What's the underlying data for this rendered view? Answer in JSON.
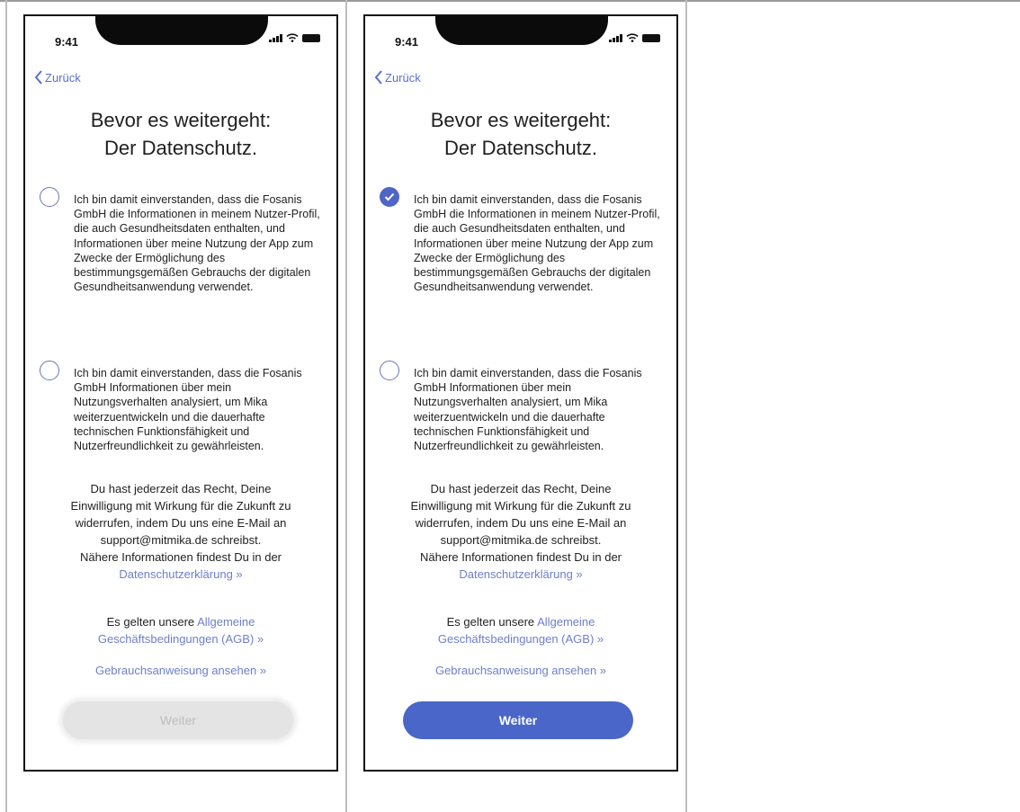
{
  "status": {
    "time": "9:41"
  },
  "nav": {
    "back_label": "Zurück"
  },
  "title": {
    "line1": "Bevor es weitergeht:",
    "line2": "Der Datenschutz."
  },
  "consents": [
    {
      "text": "Ich bin damit einverstanden, dass die Fosanis GmbH die Informationen in meinem Nutzer-Profil, die auch Gesundheitsdaten enthalten, und Informationen über meine Nutzung der App zum Zwecke der Ermöglichung des bestimmungsgemäßen Gebrauchs der digitalen Gesundheitsanwendung verwendet."
    },
    {
      "text": "Ich bin damit einverstanden, dass die Fosanis GmbH Informationen über mein Nutzungsverhalten analysiert, um Mika weiterzuentwickeln und die dauerhafte technischen Funktionsfähigkeit und Nutzerfreundlichkeit zu gewährleisten."
    }
  ],
  "info": {
    "line1": "Du hast jederzeit das Recht, Deine",
    "line2": "Einwilligung mit Wirkung für die Zukunft zu",
    "line3": "widerrufen, indem Du uns eine E-Mail an",
    "line4": "support@mitmika.de schreibst.",
    "line5": "Nähere Informationen findest Du in der",
    "privacy_link": "Datenschutzerklärung »"
  },
  "agb": {
    "prefix": "Es gelten unsere ",
    "link_part1": "Allgemeine",
    "link_part2": "Geschäftsbedingungen (AGB) »"
  },
  "manual_link": "Gebrauchsanweisung ansehen »",
  "button": {
    "label": "Weiter"
  },
  "screens": [
    {
      "consent1_checked": false,
      "consent2_checked": false,
      "button_enabled": false
    },
    {
      "consent1_checked": true,
      "consent2_checked": false,
      "button_enabled": true
    }
  ],
  "colors": {
    "accent": "#4a66c8",
    "link": "#6d7fc9",
    "disabled_button": "#e4e4e4"
  }
}
